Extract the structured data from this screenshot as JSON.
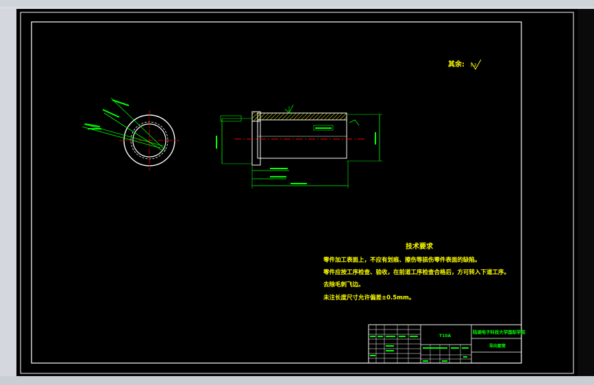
{
  "drawing": {
    "roughness_label": "其余:",
    "roughness_value": "3.2",
    "tech_title": "技术要求",
    "tech_lines": [
      "零件加工表面上，不应有划痕、擦伤等损伤零件表面的缺陷。",
      "零件应按工序检查、验收，在前道工序检查合格后，方可转入下道工序。",
      "去除毛刺飞边。",
      "未注长度尺寸允许偏差±0.5mm。"
    ]
  },
  "title_block": {
    "material": "T10A",
    "school": "陆湖电子科技大学国际学院",
    "part_name": "导向套筒"
  },
  "colors": {
    "outline": "#ffffff",
    "dimension": "#00ff00",
    "centerline": "#ff0000",
    "text": "#ffff00",
    "hatch": "#ffff00"
  }
}
